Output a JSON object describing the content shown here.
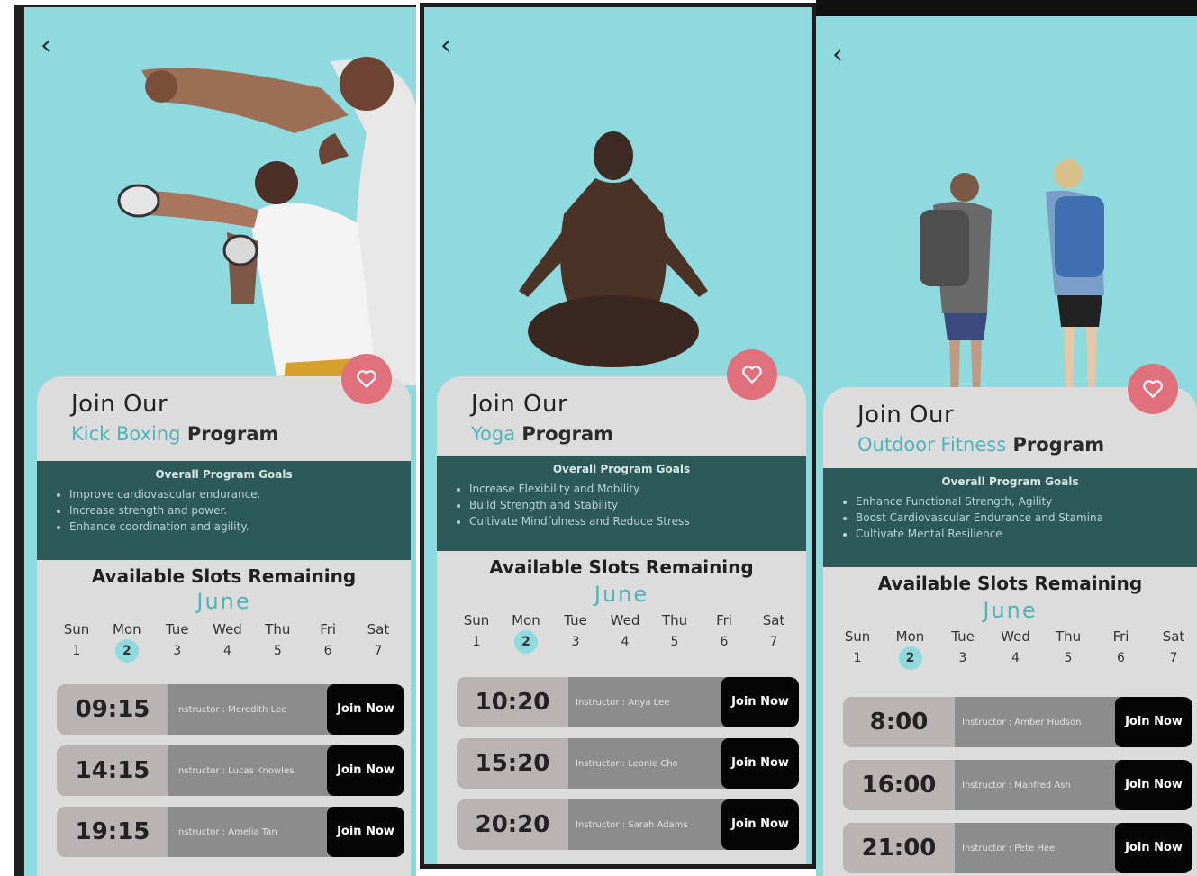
{
  "screens": [
    {
      "program_name": "Kick Boxing",
      "join_text": "Join Our",
      "program_suffix": "Program",
      "goals_title": "Overall Program Goals",
      "goals": [
        "Improve cardiovascular endurance.",
        "Increase strength and power.",
        "Enhance coordination and agility."
      ],
      "slots_title": "Available Slots Remaining",
      "month": "June",
      "days": [
        {
          "name": "Sun",
          "num": "1"
        },
        {
          "name": "Mon",
          "num": "2"
        },
        {
          "name": "Tue",
          "num": "3"
        },
        {
          "name": "Wed",
          "num": "4"
        },
        {
          "name": "Thu",
          "num": "5"
        },
        {
          "name": "Fri",
          "num": "6"
        },
        {
          "name": "Sat",
          "num": "7"
        }
      ],
      "selected_day": "2",
      "slots": [
        {
          "time": "09:15",
          "instructor": "Instructor : Meredith Lee",
          "button": "Join Now"
        },
        {
          "time": "14:15",
          "instructor": "Instructor : Lucas Knowles",
          "button": "Join Now"
        },
        {
          "time": "19:15",
          "instructor": "Instructor : Amelia Tan",
          "button": "Join Now"
        }
      ]
    },
    {
      "program_name": "Yoga",
      "join_text": "Join Our",
      "program_suffix": "Program",
      "goals_title": "Overall Program Goals",
      "goals": [
        "Increase Flexibility and Mobility",
        "Build Strength and Stability",
        "Cultivate Mindfulness and Reduce Stress"
      ],
      "slots_title": "Available Slots Remaining",
      "month": "June",
      "days": [
        {
          "name": "Sun",
          "num": "1"
        },
        {
          "name": "Mon",
          "num": "2"
        },
        {
          "name": "Tue",
          "num": "3"
        },
        {
          "name": "Wed",
          "num": "4"
        },
        {
          "name": "Thu",
          "num": "5"
        },
        {
          "name": "Fri",
          "num": "6"
        },
        {
          "name": "Sat",
          "num": "7"
        }
      ],
      "selected_day": "2",
      "slots": [
        {
          "time": "10:20",
          "instructor": "Instructor : Anya Lee",
          "button": "Join Now"
        },
        {
          "time": "15:20",
          "instructor": "Instructor : Leonie Cho",
          "button": "Join Now"
        },
        {
          "time": "20:20",
          "instructor": "Instructor : Sarah Adams",
          "button": "Join Now"
        }
      ]
    },
    {
      "program_name": "Outdoor Fitness",
      "join_text": "Join Our",
      "program_suffix": "Program",
      "goals_title": "Overall Program Goals",
      "goals": [
        "Enhance Functional Strength, Agility",
        "Boost Cardiovascular Endurance and Stamina",
        "Cultivate Mental Resilience"
      ],
      "slots_title": "Available Slots Remaining",
      "month": "June",
      "days": [
        {
          "name": "Sun",
          "num": "1"
        },
        {
          "name": "Mon",
          "num": "2"
        },
        {
          "name": "Tue",
          "num": "3"
        },
        {
          "name": "Wed",
          "num": "4"
        },
        {
          "name": "Thu",
          "num": "5"
        },
        {
          "name": "Fri",
          "num": "6"
        },
        {
          "name": "Sat",
          "num": "7"
        }
      ],
      "selected_day": "2",
      "slots": [
        {
          "time": "8:00",
          "instructor": "Instructor : Amber Hudson",
          "button": "Join Now"
        },
        {
          "time": "16:00",
          "instructor": "Instructor : Manfred Ash",
          "button": "Join Now"
        },
        {
          "time": "21:00",
          "instructor": "Instructor : Pete Hee",
          "button": "Join Now"
        }
      ]
    }
  ],
  "back_icon": "chevron-left-icon",
  "favorite_icon": "heart-icon",
  "colors": {
    "background": "#8fdadf",
    "accent": "#4fb3b9",
    "goals_band": "#2d5959",
    "heart": "#e0707c",
    "card": "#dcdcdc"
  }
}
